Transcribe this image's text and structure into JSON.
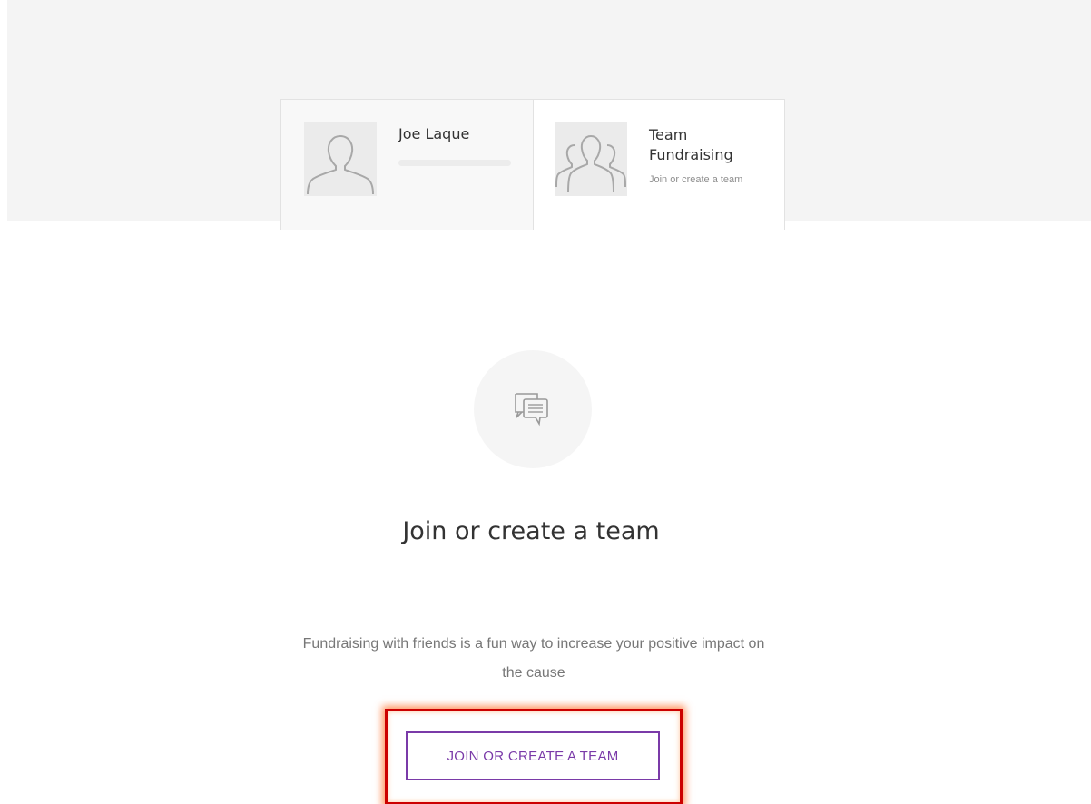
{
  "tabs": {
    "personal": {
      "name": "Joe Laque"
    },
    "team": {
      "title": "Team Fundraising",
      "subtitle": "Join or create a team"
    }
  },
  "main": {
    "icon": "chat-bubbles-icon",
    "heading": "Join or create a team",
    "description": "Fundraising with friends is a fun way to increase your positive impact on the cause",
    "button_label": "JOIN OR CREATE A TEAM"
  },
  "colors": {
    "accent": "#7a3aa8",
    "highlight_border": "#cc0000"
  }
}
